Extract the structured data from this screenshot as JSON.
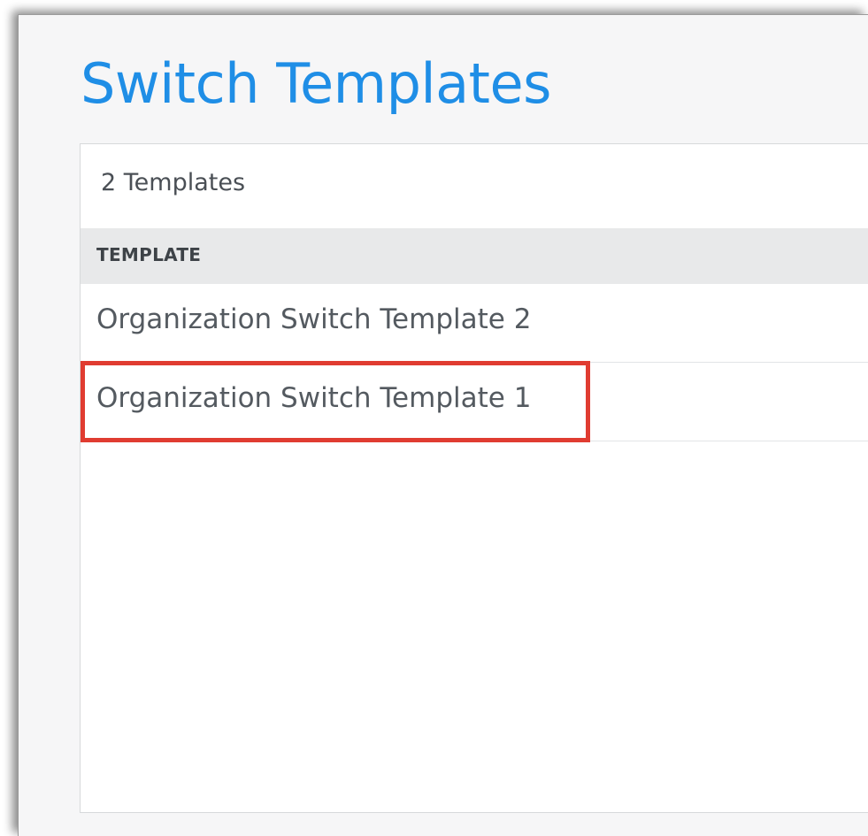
{
  "page": {
    "title": "Switch Templates"
  },
  "templates": {
    "count_label": "2 Templates",
    "column_header": "TEMPLATE",
    "rows": [
      {
        "name": "Organization Switch Template 2"
      },
      {
        "name": "Organization Switch Template 1"
      }
    ]
  },
  "colors": {
    "title": "#1f8ee6",
    "highlight": "#e03c31",
    "header_bg": "#e8e9ea"
  }
}
